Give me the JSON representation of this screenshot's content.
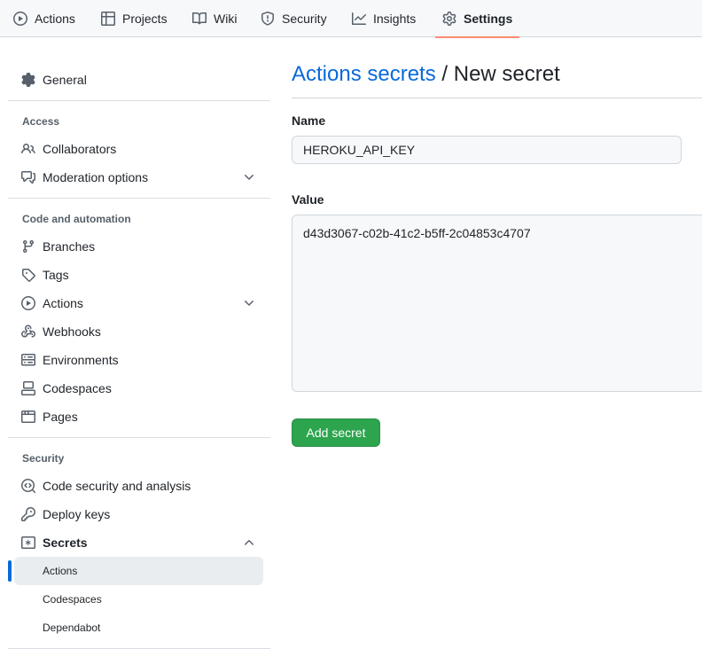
{
  "topnav": {
    "tabs": [
      {
        "label": "Actions",
        "icon": "play-icon"
      },
      {
        "label": "Projects",
        "icon": "table-icon"
      },
      {
        "label": "Wiki",
        "icon": "book-icon"
      },
      {
        "label": "Security",
        "icon": "shield-icon"
      },
      {
        "label": "Insights",
        "icon": "graph-icon"
      },
      {
        "label": "Settings",
        "icon": "gear-icon",
        "active": true
      }
    ]
  },
  "sidebar": {
    "general": "General",
    "groups": {
      "access": "Access",
      "code_automation": "Code and automation",
      "security": "Security"
    },
    "items": {
      "collaborators": "Collaborators",
      "moderation": "Moderation options",
      "branches": "Branches",
      "tags": "Tags",
      "actions": "Actions",
      "webhooks": "Webhooks",
      "environments": "Environments",
      "codespaces": "Codespaces",
      "pages": "Pages",
      "code_security": "Code security and analysis",
      "deploy_keys": "Deploy keys",
      "secrets": "Secrets"
    },
    "secrets_sub": {
      "actions": "Actions",
      "codespaces": "Codespaces",
      "dependabot": "Dependabot"
    }
  },
  "main": {
    "breadcrumb_link": "Actions secrets",
    "breadcrumb_sep": " / ",
    "breadcrumb_current": "New secret",
    "name_label": "Name",
    "name_value": "HEROKU_API_KEY",
    "value_label": "Value",
    "value_value": "d43d3067-c02b-41c2-b5ff-2c04853c4707",
    "submit_label": "Add secret"
  },
  "colors": {
    "link": "#0969da",
    "primary_button": "#2da44e",
    "active_tab_underline": "#fd8c73",
    "selected_indicator": "#0969da"
  }
}
